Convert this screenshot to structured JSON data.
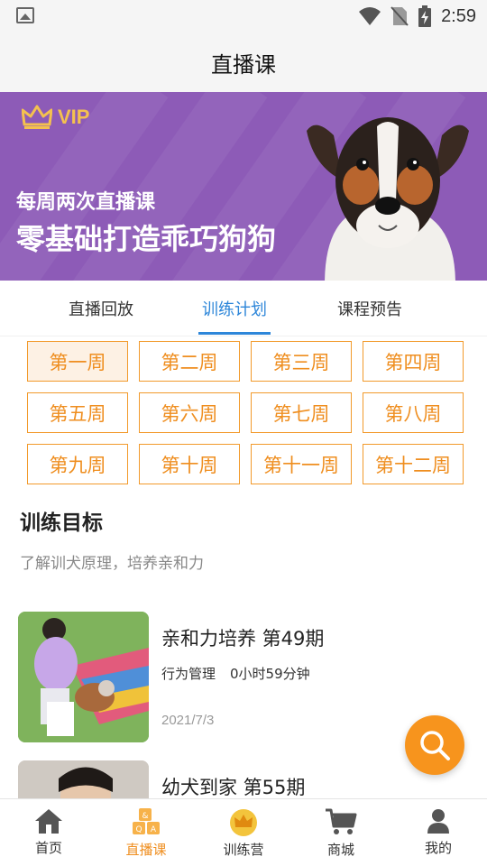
{
  "status_bar": {
    "time": "2:59"
  },
  "header": {
    "title": "直播课"
  },
  "banner": {
    "badge": "VIP",
    "line1": "每周两次直播课",
    "line2": "零基础打造乖巧狗狗"
  },
  "tabs": [
    {
      "label": "直播回放",
      "active": false
    },
    {
      "label": "训练计划",
      "active": true
    },
    {
      "label": "课程预告",
      "active": false
    }
  ],
  "weeks": [
    "第一周",
    "第二周",
    "第三周",
    "第四周",
    "第五周",
    "第六周",
    "第七周",
    "第八周",
    "第九周",
    "第十周",
    "第十一周",
    "第十二周"
  ],
  "selected_week": "第一周",
  "goal": {
    "title": "训练目标",
    "description": "了解训犬原理，培养亲和力"
  },
  "courses": [
    {
      "title": "亲和力培养 第49期",
      "category": "行为管理",
      "duration": "0小时59分钟",
      "date": "2021/7/3"
    },
    {
      "title": "幼犬到家 第55期"
    }
  ],
  "bottom_nav": [
    {
      "label": "首页",
      "icon": "home-icon",
      "active": false
    },
    {
      "label": "直播课",
      "icon": "blocks-icon",
      "active": true
    },
    {
      "label": "训练营",
      "icon": "crown-icon",
      "active": false
    },
    {
      "label": "商城",
      "icon": "cart-icon",
      "active": false
    },
    {
      "label": "我的",
      "icon": "user-icon",
      "active": false
    }
  ],
  "colors": {
    "accent": "#ef8e1f",
    "tab_active": "#2d86d9",
    "banner_bg": "#8d5bb7",
    "vip_gold": "#f4c14f"
  }
}
